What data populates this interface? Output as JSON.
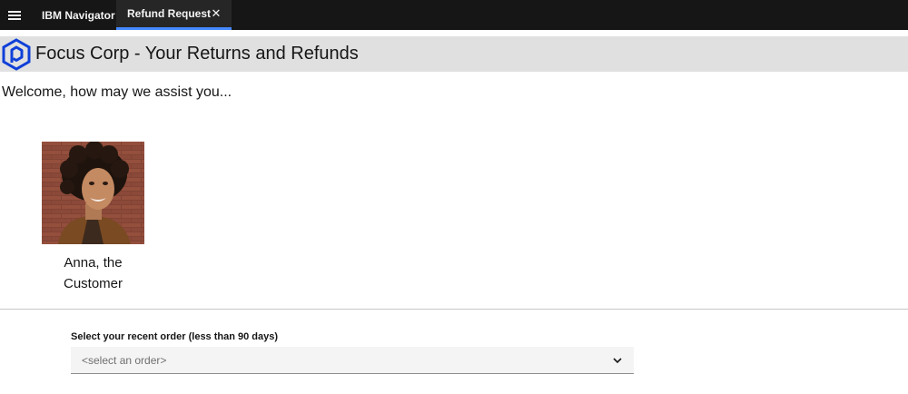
{
  "topbar": {
    "menu_icon": "hamburger-menu-icon",
    "tabs": [
      {
        "label": "IBM Navigator",
        "active": false
      },
      {
        "label": "Refund Request",
        "active": true,
        "close_icon": "close-icon"
      }
    ],
    "colors": {
      "background": "#161616",
      "active_tab_indicator": "#4589ff"
    }
  },
  "banner": {
    "logo_icon": "focus-corp-hexagon-logo",
    "title": "Focus Corp - Your Returns and Refunds",
    "colors": {
      "background": "#e0e0e0",
      "logo": "#0f3fd8"
    }
  },
  "welcome": "Welcome, how may we assist you...",
  "persona": {
    "caption": "Anna, the Customer"
  },
  "order_select": {
    "label": "Select your recent order (less than 90 days)",
    "value": "<select an order>",
    "icon": "chevron-down-icon"
  }
}
